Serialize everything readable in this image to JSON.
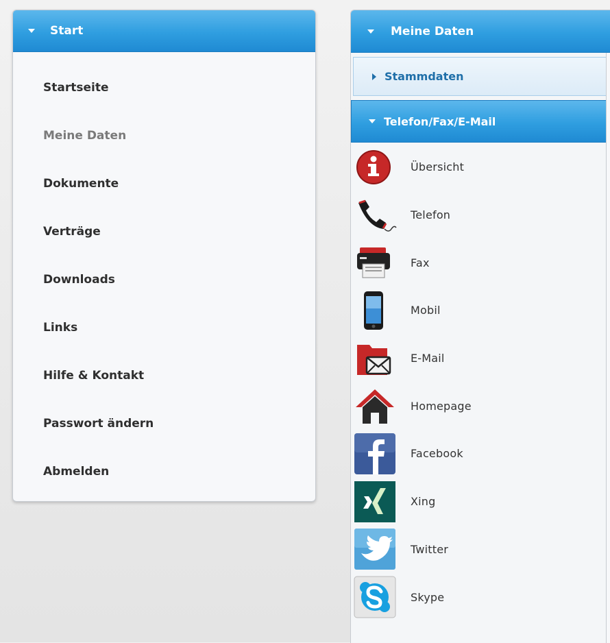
{
  "left_panel": {
    "header": "Start",
    "items": [
      {
        "label": "Startseite",
        "muted": false
      },
      {
        "label": "Meine Daten",
        "muted": true
      },
      {
        "label": "Dokumente",
        "muted": false
      },
      {
        "label": "Verträge",
        "muted": false
      },
      {
        "label": "Downloads",
        "muted": false
      },
      {
        "label": "Links",
        "muted": false
      },
      {
        "label": "Hilfe & Kontakt",
        "muted": false
      },
      {
        "label": "Passwort ändern",
        "muted": false
      },
      {
        "label": "Abmelden",
        "muted": false
      }
    ]
  },
  "right_panel": {
    "header": "Meine Daten",
    "sections": {
      "stammdaten": "Stammdaten",
      "telefon": "Telefon/Fax/E-Mail"
    },
    "items": [
      {
        "label": "Übersicht",
        "icon": "info-icon"
      },
      {
        "label": "Telefon",
        "icon": "phone-icon"
      },
      {
        "label": "Fax",
        "icon": "fax-icon"
      },
      {
        "label": "Mobil",
        "icon": "mobile-icon"
      },
      {
        "label": "E-Mail",
        "icon": "email-icon"
      },
      {
        "label": "Homepage",
        "icon": "home-icon"
      },
      {
        "label": "Facebook",
        "icon": "facebook-icon"
      },
      {
        "label": "Xing",
        "icon": "xing-icon"
      },
      {
        "label": "Twitter",
        "icon": "twitter-icon"
      },
      {
        "label": "Skype",
        "icon": "skype-icon"
      }
    ]
  },
  "colors": {
    "header_blue": "#2f9ee0",
    "subheader_text": "#1f6fa9",
    "muted_text": "#7a7a7a"
  }
}
